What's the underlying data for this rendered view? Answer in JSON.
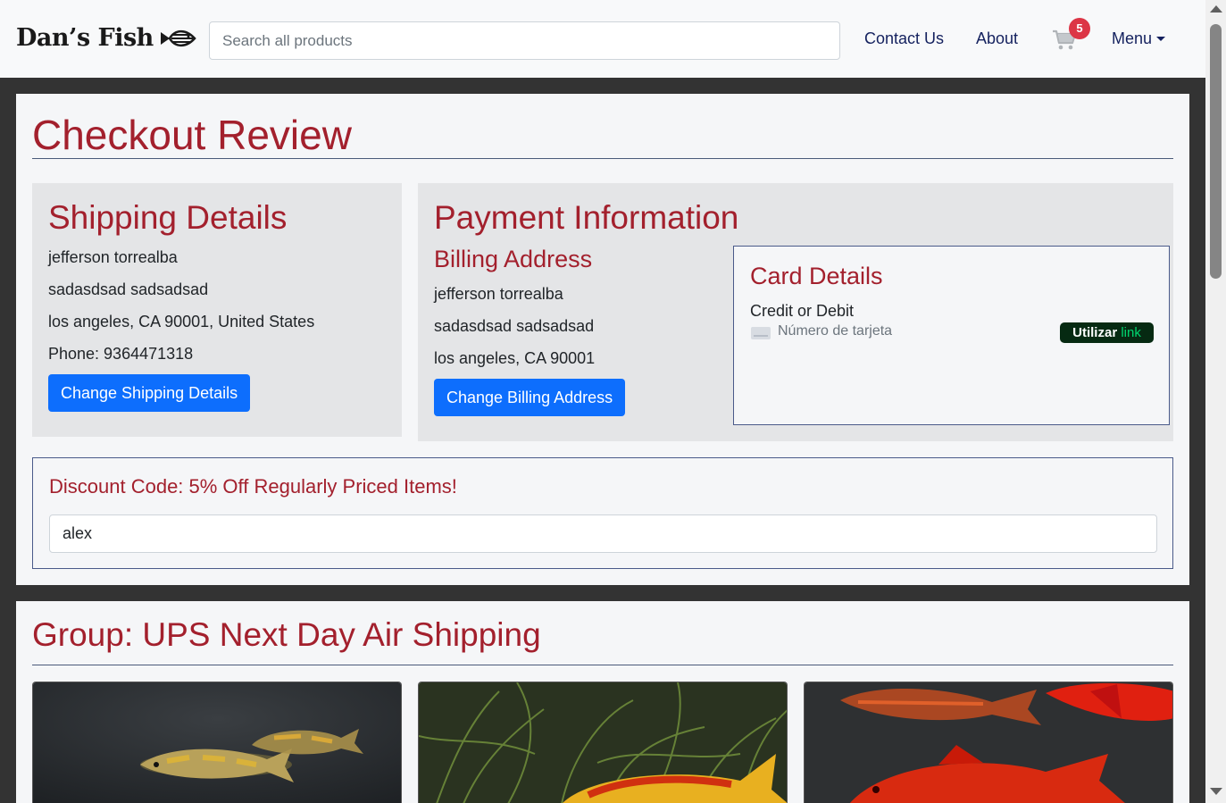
{
  "header": {
    "brand": "Dan’s Fish",
    "search_placeholder": "Search all products",
    "nav": {
      "contact": "Contact Us",
      "about": "About",
      "menu": "Menu"
    },
    "cart_count": "5"
  },
  "checkout": {
    "title": "Checkout Review",
    "shipping": {
      "heading": "Shipping Details",
      "name": "jefferson torrealba",
      "street": "sadasdsad sadsadsad",
      "city_line": "los angeles, CA 90001, United States",
      "phone": "Phone: 9364471318",
      "button": "Change Shipping Details"
    },
    "payment": {
      "heading": "Payment Information",
      "billing_heading": "Billing Address",
      "name": "jefferson torrealba",
      "street": "sadasdsad sadsadsad",
      "city_line": "los angeles, CA 90001",
      "button": "Change Billing Address",
      "card": {
        "heading": "Card Details",
        "type_label": "Credit or Debit",
        "number_placeholder": "Número de tarjeta",
        "link_prefix": "Utilizar",
        "link_word": "link"
      }
    },
    "discount": {
      "label": "Discount Code: 5% Off Regularly Priced Items!",
      "value": "alex"
    }
  },
  "group": {
    "title": "Group: UPS Next Day Air Shipping"
  },
  "colors": {
    "accent": "#a3202d",
    "primary_button": "#0d6efd",
    "nav_link": "#14215e"
  }
}
